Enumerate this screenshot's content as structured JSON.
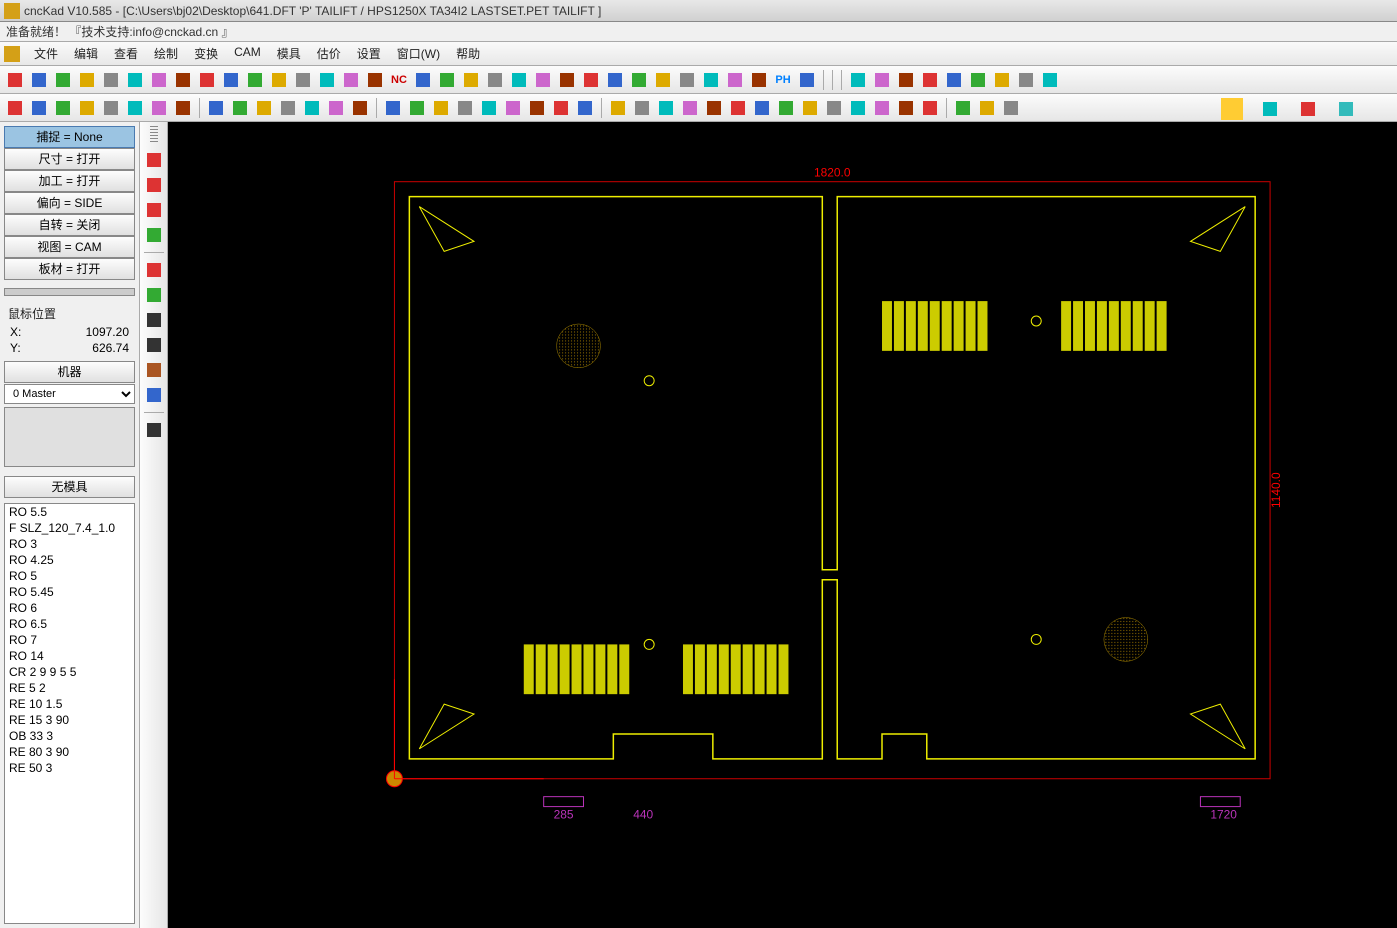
{
  "titlebar": {
    "text": "cncKad V10.585 - [C:\\Users\\bj02\\Desktop\\641.DFT  'P'  TAILIFT / HPS1250X  TA34I2  LASTSET.PET  TAILIFT ]"
  },
  "statusline": {
    "text": "准备就绪！  『技术支持:info@cnckad.cn 』"
  },
  "menu": {
    "items": [
      "文件",
      "编辑",
      "查看",
      "绘制",
      "变换",
      "CAM",
      "模具",
      "估价",
      "设置",
      "窗口(W)",
      "帮助"
    ]
  },
  "toolbar1_icons": [
    "new-file",
    "open-file",
    "save-file",
    "undo",
    "redo",
    "copy",
    "paste",
    "grid-a",
    "grid-b",
    "grid-c",
    "grid-d",
    "grid-e",
    "grid-f",
    "grid-g",
    "grid-h",
    "grid-i",
    "nc",
    "dim-a",
    "dim-b",
    "dim-c",
    "dim-d",
    "dim-e",
    "tool-a",
    "tool-b",
    "tool-c",
    "tool-d",
    "line-1",
    "line-2",
    "line-3",
    "line-4",
    "line-5",
    "line-6",
    "ph",
    "arr",
    "",
    "",
    "",
    "panel-a",
    "panel-b",
    "panel-c",
    "panel-d",
    "panel-e",
    "panel-f",
    "panel-g",
    "panel-h",
    "panel-i"
  ],
  "toolbar2_icons": [
    "line",
    "arc",
    "bez",
    "rect",
    "circ",
    "ell",
    "poly",
    "dim",
    "",
    "brush",
    "fill",
    "era",
    "sel",
    "pick",
    "mov",
    "rot",
    "",
    "cross",
    "diag",
    "cycle",
    "angle",
    "mirror",
    "box-a",
    "box-b",
    "box-c",
    "box-d",
    "",
    "l1",
    "l2",
    "l3",
    "l4",
    "l5",
    "l6",
    "l7",
    "l8",
    "l9",
    "l10",
    "l11",
    "l12",
    "l13",
    "l14",
    "",
    "p1",
    "p2",
    "p3"
  ],
  "left_panel": {
    "buttons": [
      {
        "label": "捕捉 = None",
        "highlight": true
      },
      {
        "label": "尺寸 = 打开"
      },
      {
        "label": "加工 = 打开"
      },
      {
        "label": "偏向 = SIDE"
      },
      {
        "label": "自转 = 关闭"
      },
      {
        "label": "视图 = CAM"
      },
      {
        "label": "板材 = 打开"
      }
    ],
    "mouse_label": "鼠标位置",
    "mouse_x_label": "X:",
    "mouse_x": "1097.20",
    "mouse_y_label": "Y:",
    "mouse_y": "626.74",
    "machine_btn": "机器",
    "machine_select": "0 Master",
    "tools_header": "无模具",
    "tools": [
      "RO 5.5",
      "F SLZ_120_7.4_1.0",
      "RO 3",
      "RO 4.25",
      "RO 5",
      "RO 5.45",
      "RO 6",
      "RO 6.5",
      "RO 7",
      "RO 14",
      "CR 2 9 9 5 5",
      "RE 5 2",
      "RE 10 1.5",
      "RE 15 3 90",
      "OB 33 3",
      "RE 80 3 90",
      "RE 50 3"
    ]
  },
  "vert_icons": [
    "x-red",
    "box-red",
    "xr-red",
    "green-check",
    "",
    "m-red",
    "m-green",
    "target",
    "arrow2",
    "clamp",
    "ruler",
    "",
    "text-a"
  ],
  "canvas": {
    "dim_top": "1820.0",
    "dim_right": "1140.0",
    "dim_b1": "285",
    "dim_b2": "440",
    "dim_b3": "1720"
  }
}
